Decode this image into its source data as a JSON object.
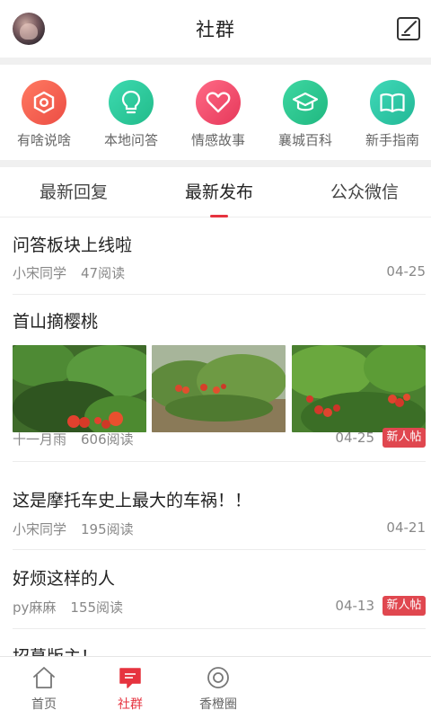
{
  "header": {
    "title": "社群"
  },
  "categories": [
    {
      "label": "有啥说啥",
      "icon": "hexagon-nut-icon",
      "color": "#f0614e"
    },
    {
      "label": "本地问答",
      "icon": "lightbulb-icon",
      "color": "#2ec99a"
    },
    {
      "label": "情感故事",
      "icon": "heart-icon",
      "color": "#f04a66"
    },
    {
      "label": "襄城百科",
      "icon": "graduation-cap-icon",
      "color": "#2cc38f"
    },
    {
      "label": "新手指南",
      "icon": "book-icon",
      "color": "#2fc6a6"
    }
  ],
  "tabs": [
    {
      "label": "最新回复"
    },
    {
      "label": "最新发布",
      "active": true
    },
    {
      "label": "公众微信"
    }
  ],
  "posts": [
    {
      "title": "问答板块上线啦",
      "author": "小宋同学",
      "reads": "47阅读",
      "date": "04-25",
      "badge": ""
    },
    {
      "title": "首山摘樱桃",
      "author": "十一月雨",
      "reads": "606阅读",
      "date": "04-25",
      "badge": "新人帖"
    },
    {
      "title": "这是摩托车史上最大的车祸！！",
      "author": "小宋同学",
      "reads": "195阅读",
      "date": "04-21",
      "badge": ""
    },
    {
      "title": "好烦这样的人",
      "author": "py麻麻",
      "reads": "155阅读",
      "date": "04-13",
      "badge": "新人帖"
    },
    {
      "title": "招募版主！"
    }
  ],
  "bottom_nav": [
    {
      "label": "首页",
      "icon": "home-icon"
    },
    {
      "label": "社群",
      "icon": "chat-bubble-icon",
      "active": true
    },
    {
      "label": "香橙圈",
      "icon": "circle-target-icon"
    }
  ],
  "colors": {
    "accent": "#e6333f",
    "badge": "#e0474f"
  }
}
